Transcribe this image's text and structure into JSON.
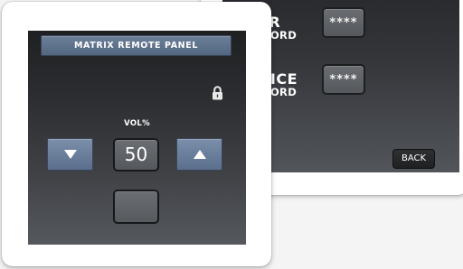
{
  "security_panel": {
    "user_password": {
      "label_line1": "ER",
      "label_line2": "WORD",
      "value": "****"
    },
    "device_password": {
      "label_line1": "VICE",
      "label_line2": "WORD",
      "value": "****"
    },
    "back_label": "BACK"
  },
  "volume_panel": {
    "title": "MATRIX REMOTE PANEL",
    "lock_icon": "lock-icon",
    "volume_label": "VOL%",
    "volume_value": "50",
    "down_icon": "triangle-down-icon",
    "up_icon": "triangle-up-icon"
  },
  "colors": {
    "title_bar": "#5f7390",
    "arrow_button": "#6b7f9c",
    "screen_top": "#1f2022",
    "screen_bottom": "#55585d",
    "display_field": "#606367",
    "panel_frame": "#ffffff"
  }
}
